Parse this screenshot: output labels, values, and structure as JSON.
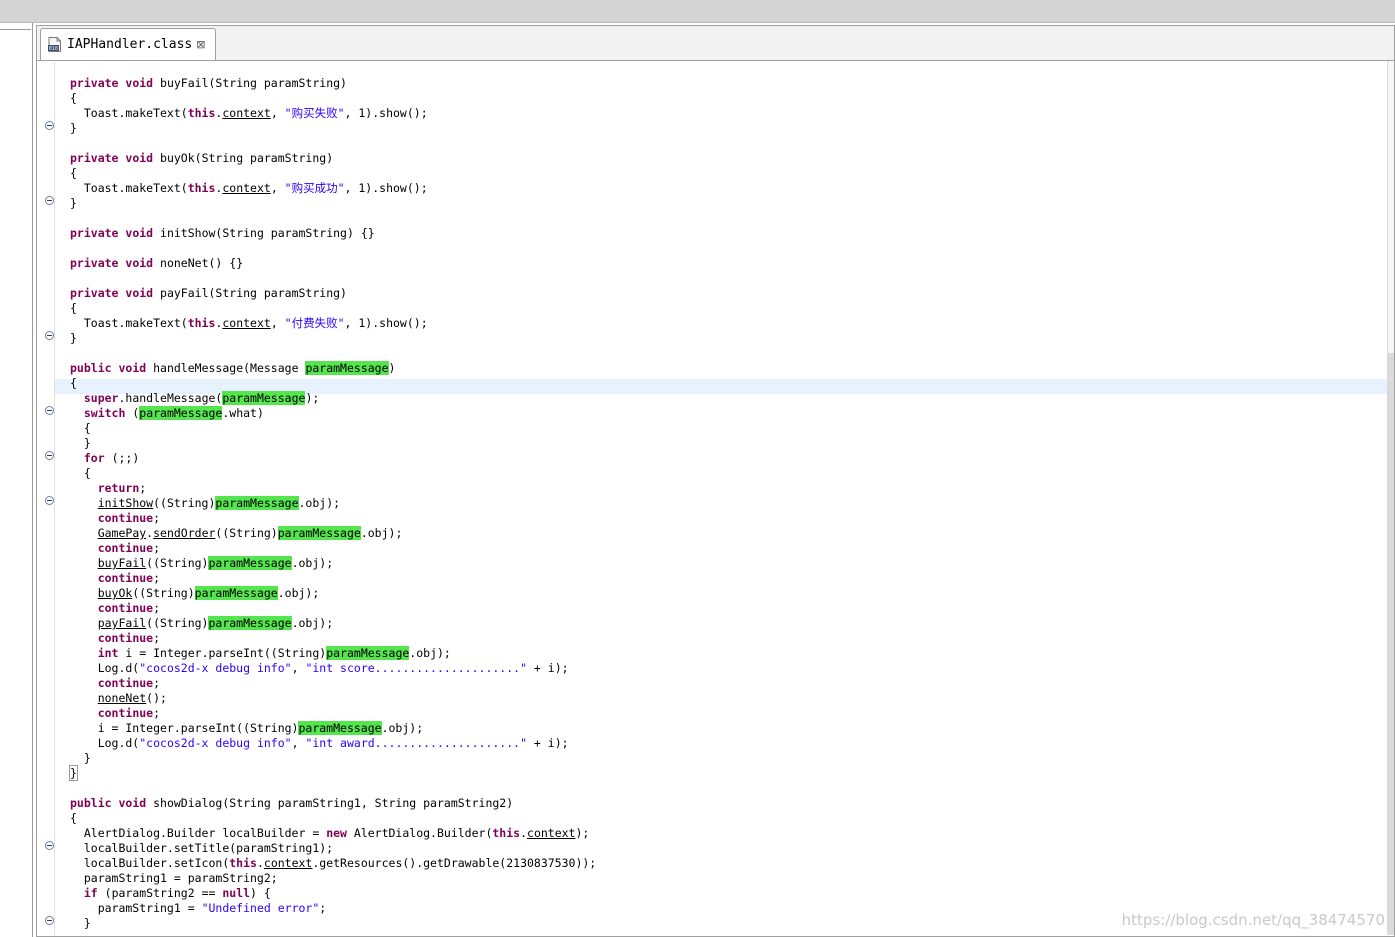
{
  "editor": {
    "tab_title": "IAPHandler.class",
    "tab_close": "⊠"
  },
  "code_lines": [
    [
      {
        "t": "private",
        "c": "kw"
      },
      {
        "t": " "
      },
      {
        "t": "void",
        "c": "kw"
      },
      {
        "t": " buyFail(String paramString)"
      }
    ],
    [
      {
        "t": "{"
      }
    ],
    [
      {
        "t": "  Toast.makeText("
      },
      {
        "t": "this",
        "c": "kw"
      },
      {
        "t": "."
      },
      {
        "t": "context",
        "c": "u"
      },
      {
        "t": ", "
      },
      {
        "t": "\"购买失败\"",
        "c": "str"
      },
      {
        "t": ", 1).show();"
      }
    ],
    [
      {
        "t": "}"
      }
    ],
    [],
    [
      {
        "t": "private",
        "c": "kw"
      },
      {
        "t": " "
      },
      {
        "t": "void",
        "c": "kw"
      },
      {
        "t": " buyOk(String paramString)"
      }
    ],
    [
      {
        "t": "{"
      }
    ],
    [
      {
        "t": "  Toast.makeText("
      },
      {
        "t": "this",
        "c": "kw"
      },
      {
        "t": "."
      },
      {
        "t": "context",
        "c": "u"
      },
      {
        "t": ", "
      },
      {
        "t": "\"购买成功\"",
        "c": "str"
      },
      {
        "t": ", 1).show();"
      }
    ],
    [
      {
        "t": "}"
      }
    ],
    [],
    [
      {
        "t": "private",
        "c": "kw"
      },
      {
        "t": " "
      },
      {
        "t": "void",
        "c": "kw"
      },
      {
        "t": " initShow(String paramString) {}"
      }
    ],
    [],
    [
      {
        "t": "private",
        "c": "kw"
      },
      {
        "t": " "
      },
      {
        "t": "void",
        "c": "kw"
      },
      {
        "t": " noneNet() {}"
      }
    ],
    [],
    [
      {
        "t": "private",
        "c": "kw"
      },
      {
        "t": " "
      },
      {
        "t": "void",
        "c": "kw"
      },
      {
        "t": " payFail(String paramString)"
      }
    ],
    [
      {
        "t": "{"
      }
    ],
    [
      {
        "t": "  Toast.makeText("
      },
      {
        "t": "this",
        "c": "kw"
      },
      {
        "t": "."
      },
      {
        "t": "context",
        "c": "u"
      },
      {
        "t": ", "
      },
      {
        "t": "\"付费失败\"",
        "c": "str"
      },
      {
        "t": ", 1).show();"
      }
    ],
    [
      {
        "t": "}"
      }
    ],
    [],
    [
      {
        "t": "public",
        "c": "kw"
      },
      {
        "t": " "
      },
      {
        "t": "void",
        "c": "kw"
      },
      {
        "t": " handleMessage(Message "
      },
      {
        "t": "paramMessage",
        "c": "mark"
      },
      {
        "t": ")"
      }
    ],
    [
      {
        "t": "{"
      }
    ],
    [
      {
        "t": "  "
      },
      {
        "t": "super",
        "c": "kw"
      },
      {
        "t": ".handleMessage("
      },
      {
        "t": "paramMessage",
        "c": "mark"
      },
      {
        "t": ");"
      }
    ],
    [
      {
        "t": "  "
      },
      {
        "t": "switch",
        "c": "kw"
      },
      {
        "t": " ("
      },
      {
        "t": "paramMessage",
        "c": "mark"
      },
      {
        "t": ".what)"
      }
    ],
    [
      {
        "t": "  {"
      }
    ],
    [
      {
        "t": "  }"
      }
    ],
    [
      {
        "t": "  "
      },
      {
        "t": "for",
        "c": "kw"
      },
      {
        "t": " (;;)"
      }
    ],
    [
      {
        "t": "  {"
      }
    ],
    [
      {
        "t": "    "
      },
      {
        "t": "return",
        "c": "kw"
      },
      {
        "t": ";"
      }
    ],
    [
      {
        "t": "    "
      },
      {
        "t": "initShow",
        "c": "u"
      },
      {
        "t": "((String)"
      },
      {
        "t": "paramMessage",
        "c": "mark"
      },
      {
        "t": ".obj);"
      }
    ],
    [
      {
        "t": "    "
      },
      {
        "t": "continue",
        "c": "kw"
      },
      {
        "t": ";"
      }
    ],
    [
      {
        "t": "    "
      },
      {
        "t": "GamePay",
        "c": "u"
      },
      {
        "t": "."
      },
      {
        "t": "sendOrder",
        "c": "u"
      },
      {
        "t": "((String)"
      },
      {
        "t": "paramMessage",
        "c": "mark"
      },
      {
        "t": ".obj);"
      }
    ],
    [
      {
        "t": "    "
      },
      {
        "t": "continue",
        "c": "kw"
      },
      {
        "t": ";"
      }
    ],
    [
      {
        "t": "    "
      },
      {
        "t": "buyFail",
        "c": "u"
      },
      {
        "t": "((String)"
      },
      {
        "t": "paramMessage",
        "c": "mark"
      },
      {
        "t": ".obj);"
      }
    ],
    [
      {
        "t": "    "
      },
      {
        "t": "continue",
        "c": "kw"
      },
      {
        "t": ";"
      }
    ],
    [
      {
        "t": "    "
      },
      {
        "t": "buyOk",
        "c": "u"
      },
      {
        "t": "((String)"
      },
      {
        "t": "paramMessage",
        "c": "mark"
      },
      {
        "t": ".obj);"
      }
    ],
    [
      {
        "t": "    "
      },
      {
        "t": "continue",
        "c": "kw"
      },
      {
        "t": ";"
      }
    ],
    [
      {
        "t": "    "
      },
      {
        "t": "payFail",
        "c": "u"
      },
      {
        "t": "((String)"
      },
      {
        "t": "paramMessage",
        "c": "mark"
      },
      {
        "t": ".obj);"
      }
    ],
    [
      {
        "t": "    "
      },
      {
        "t": "continue",
        "c": "kw"
      },
      {
        "t": ";"
      }
    ],
    [
      {
        "t": "    "
      },
      {
        "t": "int",
        "c": "kw"
      },
      {
        "t": " i = Integer.parseInt((String)"
      },
      {
        "t": "paramMessage",
        "c": "mark"
      },
      {
        "t": ".obj);"
      }
    ],
    [
      {
        "t": "    Log.d("
      },
      {
        "t": "\"cocos2d-x debug info\"",
        "c": "str"
      },
      {
        "t": ", "
      },
      {
        "t": "\"int score.....................\"",
        "c": "str"
      },
      {
        "t": " + i);"
      }
    ],
    [
      {
        "t": "    "
      },
      {
        "t": "continue",
        "c": "kw"
      },
      {
        "t": ";"
      }
    ],
    [
      {
        "t": "    "
      },
      {
        "t": "noneNet",
        "c": "u"
      },
      {
        "t": "();"
      }
    ],
    [
      {
        "t": "    "
      },
      {
        "t": "continue",
        "c": "kw"
      },
      {
        "t": ";"
      }
    ],
    [
      {
        "t": "    i = Integer.parseInt((String)"
      },
      {
        "t": "paramMessage",
        "c": "mark"
      },
      {
        "t": ".obj);"
      }
    ],
    [
      {
        "t": "    Log.d("
      },
      {
        "t": "\"cocos2d-x debug info\"",
        "c": "str"
      },
      {
        "t": ", "
      },
      {
        "t": "\"int award.....................\"",
        "c": "str"
      },
      {
        "t": " + i);"
      }
    ],
    [
      {
        "t": "  }"
      }
    ],
    [
      {
        "t": "}",
        "c": "brk"
      }
    ],
    [],
    [
      {
        "t": "public",
        "c": "kw"
      },
      {
        "t": " "
      },
      {
        "t": "void",
        "c": "kw"
      },
      {
        "t": " showDialog(String paramString1, String paramString2)"
      }
    ],
    [
      {
        "t": "{"
      }
    ],
    [
      {
        "t": "  AlertDialog.Builder localBuilder = "
      },
      {
        "t": "new",
        "c": "kw"
      },
      {
        "t": " AlertDialog.Builder("
      },
      {
        "t": "this",
        "c": "kw"
      },
      {
        "t": "."
      },
      {
        "t": "context",
        "c": "u"
      },
      {
        "t": ");"
      }
    ],
    [
      {
        "t": "  localBuilder.setTitle(paramString1);"
      }
    ],
    [
      {
        "t": "  localBuilder.setIcon("
      },
      {
        "t": "this",
        "c": "kw"
      },
      {
        "t": "."
      },
      {
        "t": "context",
        "c": "u"
      },
      {
        "t": ".getResources().getDrawable(2130837530));"
      }
    ],
    [
      {
        "t": "  paramString1 = paramString2;"
      }
    ],
    [
      {
        "t": "  "
      },
      {
        "t": "if",
        "c": "kw"
      },
      {
        "t": " (paramString2 == "
      },
      {
        "t": "null",
        "c": "kw"
      },
      {
        "t": ") {"
      }
    ],
    [
      {
        "t": "    paramString1 = "
      },
      {
        "t": "\"Undefined error\"",
        "c": "str"
      },
      {
        "t": ";"
      }
    ],
    [
      {
        "t": "  }"
      }
    ]
  ],
  "watermark": "https://blog.csdn.net/qq_38474570"
}
